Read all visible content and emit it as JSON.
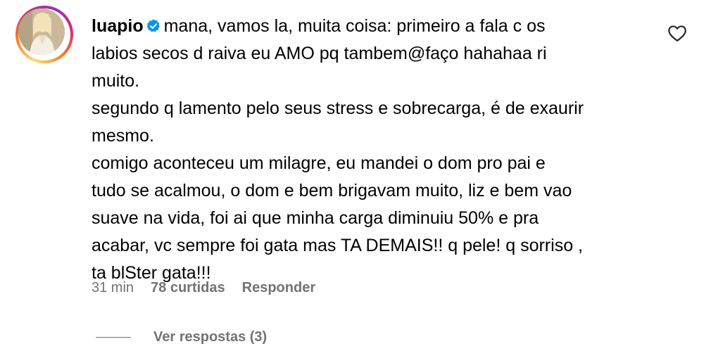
{
  "comment": {
    "username": "luapio",
    "text_lines": [
      "mana, vamos la, muita coisa: primeiro a fala c os",
      "labios secos d raiva eu AMO pq tambem@faço hahahaa ri",
      "muito.",
      "segundo q lamento pelo seus stress e sobrecarga, é de exaurir",
      "mesmo.",
      "comigo aconteceu um milagre, eu mandei o dom pro pai e",
      "tudo se acalmou, o dom e bem brigavam muito, liz e bem vao",
      "suave na vida, foi ai que minha carga diminuiu 50% e pra",
      "acabar, vc sempre foi gata mas TA DEMAIS!! q pele! q sorriso ,",
      "ta blSter gata!!!"
    ],
    "time": "31 min",
    "likes": "78 curtidas",
    "reply_label": "Responder",
    "view_replies": "Ver respostas (3)"
  },
  "icons": {
    "verified": "verified-badge-icon",
    "like": "heart-outline-icon"
  },
  "colors": {
    "verified_blue": "#0095f6",
    "meta_gray": "#737373",
    "text": "#000000"
  }
}
